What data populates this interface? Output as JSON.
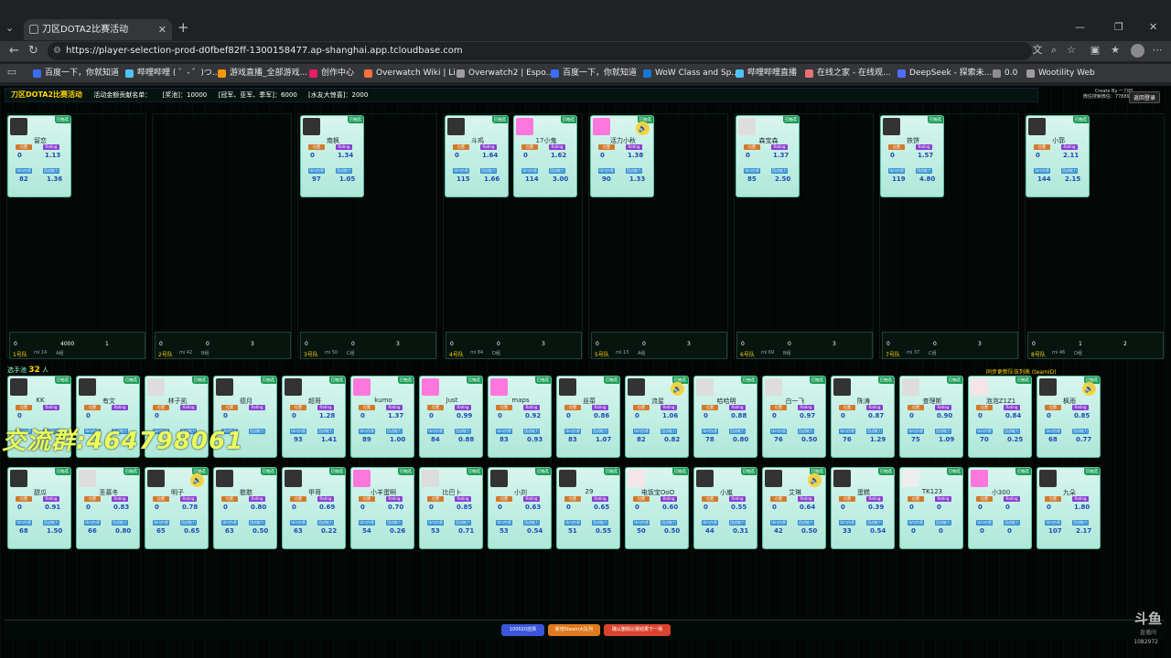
{
  "browser": {
    "tab_title": "刀区DOTA2比赛活动",
    "url": "https://player-selection-prod-d0fbef82ff-1300158477.ap-shanghai.app.tcloudbase.com",
    "bookmarks": [
      "百度一下，你就知道",
      "哔哩哔哩 ( ゜- ゜)つ...",
      "游戏直播_全部游戏...",
      "创作中心",
      "Overwatch Wiki | Li...",
      "Overwatch2 | Espo...",
      "百度一下，你就知道",
      "WoW Class and Sp...",
      "哔哩哔哩直播",
      "在线之家 - 在线观...",
      "DeepSeek - 探索未...",
      "0.0",
      "Wootility Web"
    ]
  },
  "header": {
    "title": "刀区DOTA2比赛活动",
    "subtitle": "活动金额贡献名单：",
    "pool": "[奖池]：",
    "pool_val": "10000",
    "champ": "[冠军、亚军、季军]：",
    "champ_val": "6000",
    "fan": "[水友大惊喜]：",
    "fan_val": "2000",
    "credit1": "Create By 一刀切",
    "credit2": "微信搜索微信：778894",
    "back_btn": "返回登录"
  },
  "labels": {
    "pos": "位置",
    "rating": "Rating",
    "stat3": "场均伤害",
    "stat4": "团战能力",
    "tag": "已抽选"
  },
  "teams": [
    {
      "name": "1号队",
      "avg": "mi 14",
      "grp": "A组",
      "f1": "0",
      "f2": "4000",
      "f3": "1"
    },
    {
      "name": "2号队",
      "avg": "mi 42",
      "grp": "B组",
      "f1": "0",
      "f2": "0",
      "f3": "3"
    },
    {
      "name": "3号队",
      "avg": "mi 50",
      "grp": "C组",
      "f1": "0",
      "f2": "0",
      "f3": "3"
    },
    {
      "name": "4号队",
      "avg": "mi 84",
      "grp": "D组",
      "f1": "0",
      "f2": "0",
      "f3": "3"
    },
    {
      "name": "5号队",
      "avg": "mi 13",
      "grp": "A组",
      "f1": "0",
      "f2": "0",
      "f3": "3"
    },
    {
      "name": "6号队",
      "avg": "mi 69",
      "grp": "B组",
      "f1": "0",
      "f2": "0",
      "f3": "3"
    },
    {
      "name": "7号队",
      "avg": "mi 37",
      "grp": "C组",
      "f1": "0",
      "f2": "0",
      "f3": "3"
    },
    {
      "name": "8号队",
      "avg": "mi 46",
      "grp": "D组",
      "f1": "0",
      "f2": "1",
      "f3": "2"
    }
  ],
  "team_cards": [
    {
      "name": "留恋",
      "p": "0",
      "r": "1.13",
      "a": "82",
      "b": "1.36"
    },
    {
      "name": "南枫",
      "p": "0",
      "r": "1.34",
      "a": "97",
      "b": "1.05"
    },
    {
      "name": "斗鸡",
      "p": "0",
      "r": "1.64",
      "a": "115",
      "b": "1.66"
    },
    {
      "name": "17小鬼",
      "p": "0",
      "r": "1.62",
      "a": "114",
      "b": "3.00"
    },
    {
      "name": "活力小秋",
      "p": "0",
      "r": "1.38",
      "a": "90",
      "b": "1.33"
    },
    {
      "name": "森宝森",
      "p": "0",
      "r": "1.37",
      "a": "85",
      "b": "2.50"
    },
    {
      "name": "铁饼",
      "p": "0",
      "r": "1.57",
      "a": "119",
      "b": "4.80"
    },
    {
      "name": "小郭",
      "p": "0",
      "r": "2.11",
      "a": "144",
      "b": "2.15"
    }
  ],
  "pool_count": "32",
  "pool_label": "选手池",
  "pool_row1": [
    {
      "name": "KK",
      "p": "0",
      "r": "",
      "a": "",
      "b": ""
    },
    {
      "name": "有文",
      "p": "0",
      "r": "",
      "a": "",
      "b": ""
    },
    {
      "name": "林子凯",
      "p": "0",
      "r": "",
      "a": "",
      "b": ""
    },
    {
      "name": "德月",
      "p": "0",
      "r": "",
      "a": "",
      "b": ""
    },
    {
      "name": "超哥",
      "p": "0",
      "r": "1.28",
      "a": "93",
      "b": "1.41"
    },
    {
      "name": "kumo",
      "p": "0",
      "r": "1.37",
      "a": "89",
      "b": "1.00"
    },
    {
      "name": "Just",
      "p": "0",
      "r": "0.99",
      "a": "84",
      "b": "0.88"
    },
    {
      "name": "maps",
      "p": "0",
      "r": "0.92",
      "a": "83",
      "b": "0.93"
    },
    {
      "name": "韭菜",
      "p": "0",
      "r": "0.86",
      "a": "83",
      "b": "1.07"
    },
    {
      "name": "流星",
      "p": "0",
      "r": "1.06",
      "a": "82",
      "b": "0.82"
    },
    {
      "name": "哈哈明",
      "p": "0",
      "r": "0.88",
      "a": "78",
      "b": "0.80"
    },
    {
      "name": "白一飞",
      "p": "0",
      "r": "0.97",
      "a": "76",
      "b": "0.50"
    },
    {
      "name": "陈涛",
      "p": "0",
      "r": "0.87",
      "a": "76",
      "b": "1.29"
    },
    {
      "name": "查理斯",
      "p": "0",
      "r": "0.90",
      "a": "75",
      "b": "1.09"
    },
    {
      "name": "泡泡Z1Z1",
      "p": "0",
      "r": "0.84",
      "a": "70",
      "b": "0.25"
    },
    {
      "name": "枫雨",
      "p": "0",
      "r": "0.85",
      "a": "68",
      "b": "0.77"
    }
  ],
  "pool_row2": [
    {
      "name": "甜瓜",
      "p": "0",
      "r": "0.91",
      "a": "68",
      "b": "1.50"
    },
    {
      "name": "圣慕冬",
      "p": "0",
      "r": "0.83",
      "a": "66",
      "b": "0.80"
    },
    {
      "name": "明子",
      "p": "0",
      "r": "0.78",
      "a": "65",
      "b": "0.65"
    },
    {
      "name": "憨憨",
      "p": "0",
      "r": "0.80",
      "a": "63",
      "b": "0.50"
    },
    {
      "name": "甲哥",
      "p": "0",
      "r": "0.69",
      "a": "63",
      "b": "0.22"
    },
    {
      "name": "小羊蛋啊",
      "p": "0",
      "r": "0.70",
      "a": "54",
      "b": "0.26"
    },
    {
      "name": "比巴卜",
      "p": "0",
      "r": "0.85",
      "a": "53",
      "b": "0.71"
    },
    {
      "name": "小刘",
      "p": "0",
      "r": "0.63",
      "a": "53",
      "b": "0.54"
    },
    {
      "name": "29",
      "p": "0",
      "r": "0.65",
      "a": "51",
      "b": "0.55"
    },
    {
      "name": "电饭宝OoO",
      "p": "0",
      "r": "0.60",
      "a": "50",
      "b": "0.50"
    },
    {
      "name": "小嵐",
      "p": "0",
      "r": "0.55",
      "a": "44",
      "b": "0.31"
    },
    {
      "name": "艾琳",
      "p": "0",
      "r": "0.64",
      "a": "42",
      "b": "0.50"
    },
    {
      "name": "蛋糕",
      "p": "0",
      "r": "0.39",
      "a": "33",
      "b": "0.54"
    },
    {
      "name": "TK123",
      "p": "0",
      "r": "0",
      "a": "0",
      "b": "0"
    },
    {
      "name": "小300",
      "p": "0",
      "r": "0",
      "a": "0",
      "b": "0"
    },
    {
      "name": "九朵",
      "p": "0",
      "r": "1.80",
      "a": "107",
      "b": "2.17"
    }
  ],
  "overlay_qq": "交流群:464798061",
  "notice": "同步更新队伍列表 (teamID)",
  "buttons": {
    "b1": "100020选择",
    "b2": "新增Steam大队列",
    "b3": "确认删除比赛结果下一场"
  },
  "douyu": {
    "logo": "斗鱼",
    "sub": "直播间",
    "viewers": "1082972"
  },
  "colors": {
    "card_top": "#d8f6ee",
    "card_bottom": "#aee7d9",
    "accent": "#1c9c55",
    "gold": "#ffd400"
  }
}
